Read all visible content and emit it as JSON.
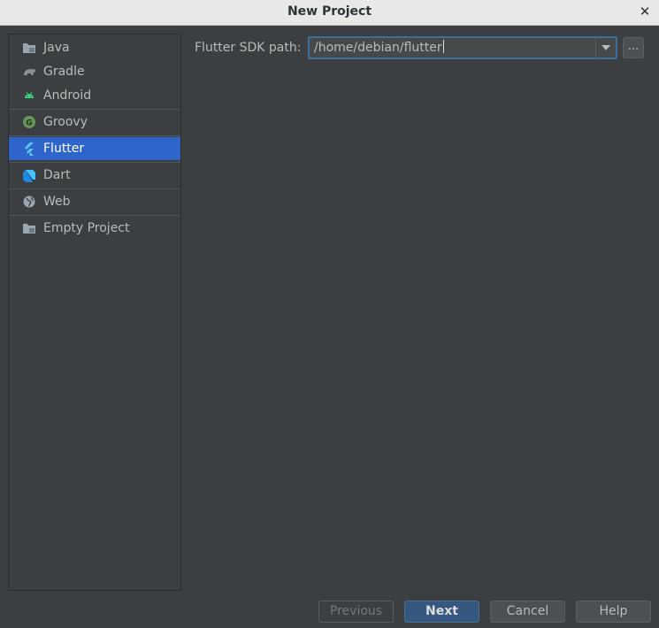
{
  "window": {
    "title": "New Project"
  },
  "sidebar": {
    "items": [
      {
        "label": "Java",
        "icon": "folder-icon"
      },
      {
        "label": "Gradle",
        "icon": "gradle-icon"
      },
      {
        "label": "Android",
        "icon": "android-icon"
      },
      {
        "label": "Groovy",
        "icon": "groovy-icon"
      },
      {
        "label": "Flutter",
        "icon": "flutter-icon",
        "selected": true
      },
      {
        "label": "Dart",
        "icon": "dart-icon"
      },
      {
        "label": "Web",
        "icon": "globe-icon"
      },
      {
        "label": "Empty Project",
        "icon": "folder-icon"
      }
    ]
  },
  "form": {
    "sdk_label": "Flutter SDK path:",
    "sdk_value": "/home/debian/flutter",
    "browse_label": "..."
  },
  "buttons": {
    "previous": "Previous",
    "next": "Next",
    "cancel": "Cancel",
    "help": "Help"
  },
  "colors": {
    "background": "#3c3f41",
    "selection": "#2f65ca",
    "primary_button": "#365880",
    "focus_border": "#3d6f9e"
  }
}
